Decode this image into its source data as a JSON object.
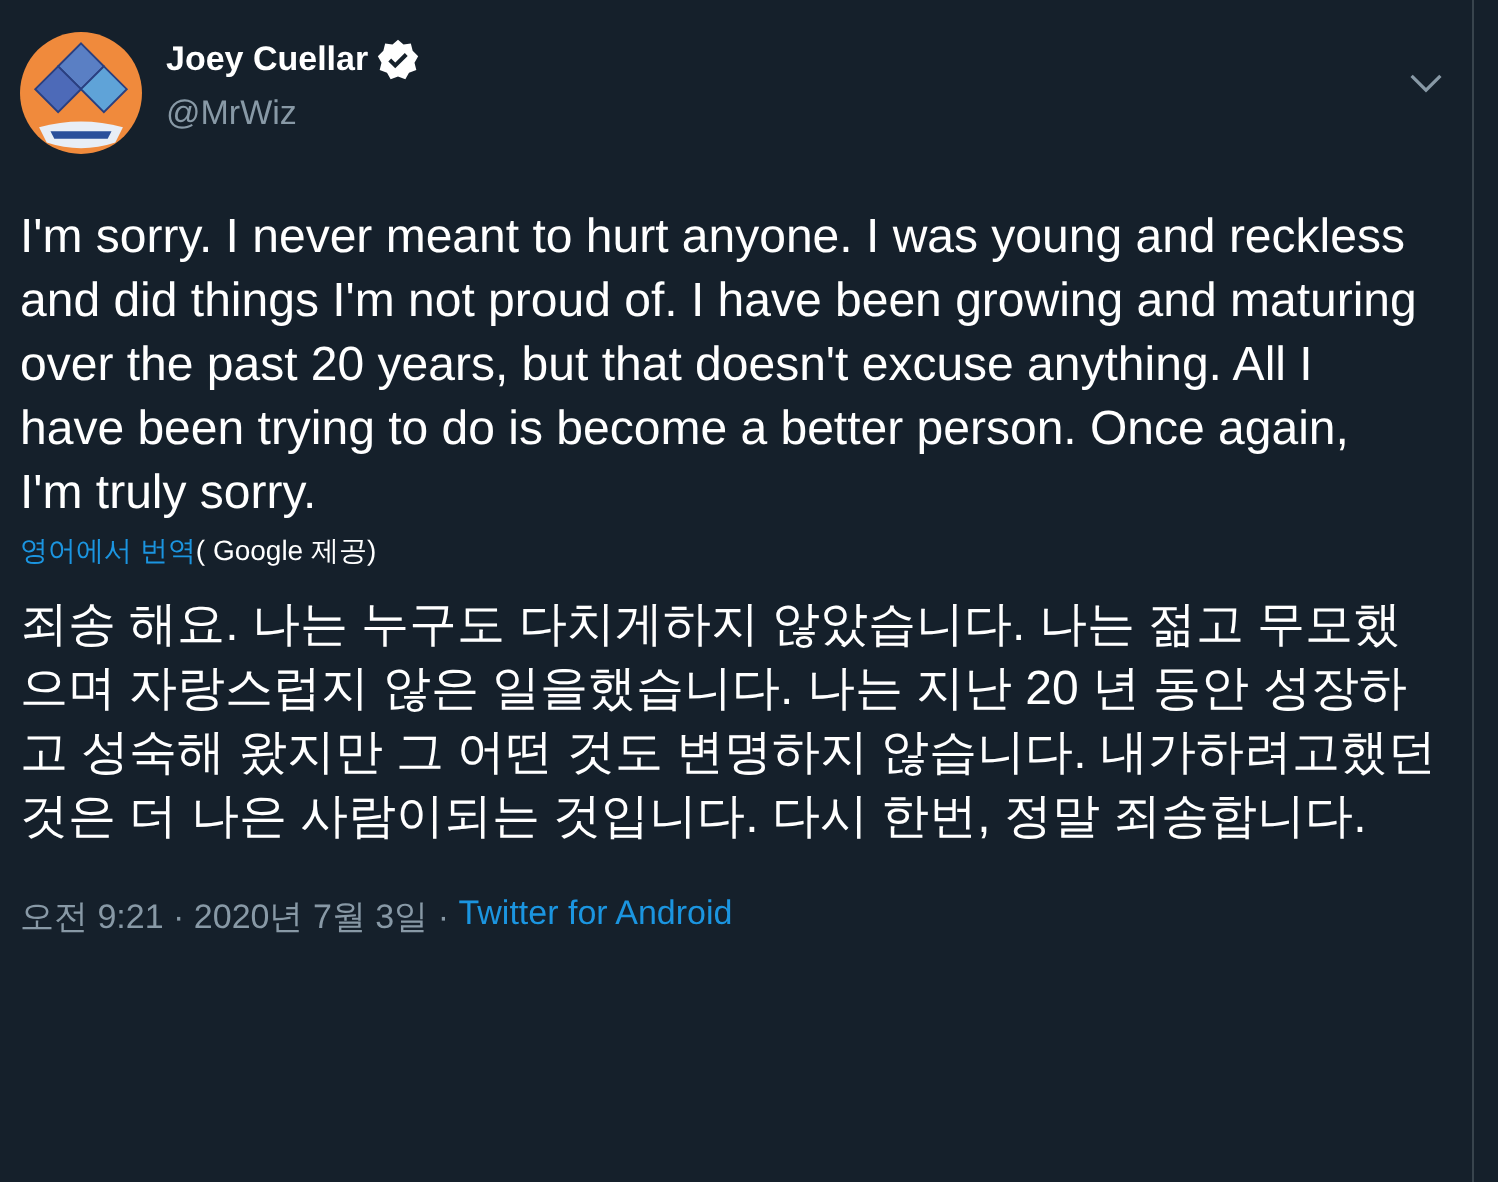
{
  "author": {
    "name": "Joey Cuellar",
    "verified": true,
    "handle": "@MrWiz"
  },
  "tweet": {
    "text": "I'm sorry. I never meant to hurt anyone.  I was young and reckless and did things I'm not proud of. I have been growing and maturing over the past 20 years, but that doesn't excuse anything. All I have been trying to do is become a better person. Once again, I'm truly sorry.",
    "translate_link": "영어에서 번역",
    "translate_credit": "( Google 제공)",
    "translation": "죄송 해요. 나는 누구도 다치게하지 않았습니다. 나는 젊고 무모했으며 자랑스럽지 않은 일을했습니다. 나는 지난 20 년 동안 성장하고 성숙해 왔지만 그 어떤 것도 변명하지 않습니다. 내가하려고했던 것은 더 나은 사람이되는 것입니다. 다시 한번, 정말 죄송합니다.",
    "timestamp": "오전 9:21 · 2020년 7월 3일 · ",
    "source": "Twitter for Android"
  }
}
